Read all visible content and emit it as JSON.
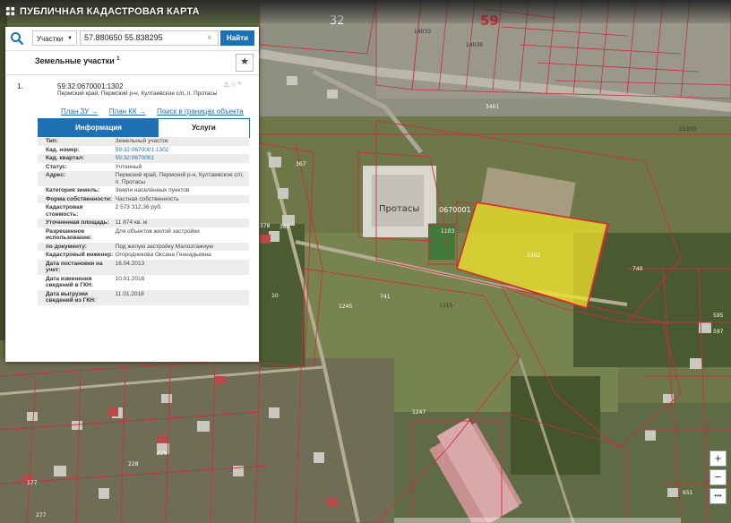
{
  "app": {
    "title": "ПУБЛИЧНАЯ КАДАСТРОВАЯ КАРТА"
  },
  "search": {
    "type_label": "Участки",
    "query": "57.880650 55.838295",
    "find_label": "Найти"
  },
  "panel": {
    "title": "Земельные участки",
    "title_sup": "1"
  },
  "result": {
    "number": "1.",
    "cad_number": "59:32:0670001:1302",
    "address": "Пермский край, Пермский р-н, Култаевское с/п, п. Протасы",
    "links": [
      "План ЗУ →",
      "План КК →",
      "Поиск в границах объекта →"
    ]
  },
  "tabs": {
    "info": "Информация",
    "services": "Услуги"
  },
  "properties": [
    {
      "label": "Тип:",
      "value": "Земельный участок"
    },
    {
      "label": "Кад. номер:",
      "value": "59:32:0670001:1302"
    },
    {
      "label": "Кад. квартал:",
      "value": "59:32:0670001"
    },
    {
      "label": "Статус:",
      "value": "Учтенный"
    },
    {
      "label": "Адрес:",
      "value": "Пермский край, Пермский р-н, Култаевское с/п, п. Протасы"
    },
    {
      "label": "Категория земель:",
      "value": "Земли населённых пунктов"
    },
    {
      "label": "Форма собственности:",
      "value": "Частная собственность"
    },
    {
      "label": "Кадастровая стоимость:",
      "value": "2 573 312,36 руб."
    },
    {
      "label": "Уточненная площадь:",
      "value": "11 874 кв. м"
    },
    {
      "label": "Разрешенное использование:",
      "value": "Для объектов жилой застройки"
    },
    {
      "label": "по документу:",
      "value": "Под жилую застройку Малоэтажную"
    },
    {
      "label": "Кадастровый инженер:",
      "value": "Огородникова Оксана Геннадьевна"
    },
    {
      "label": "Дата постановки на учет:",
      "value": "16.04.2013"
    },
    {
      "label": "Дата изменения сведений в ГКН:",
      "value": "10.01.2018"
    },
    {
      "label": "Дата выгрузки сведений из ГКН:",
      "value": "11.01.2018"
    }
  ],
  "map": {
    "labels": [
      {
        "text": "59",
        "kind": "big"
      },
      {
        "text": "32",
        "kind": "big"
      },
      {
        "text": "Протасы",
        "kind": "place"
      },
      {
        "text": "0670001",
        "kind": "quarter"
      },
      {
        "text": "1302",
        "kind": "parcel"
      },
      {
        "text": "1103",
        "kind": "parcel"
      },
      {
        "text": "3401",
        "kind": "parcel"
      },
      {
        "text": "740",
        "kind": "parcel"
      },
      {
        "text": "741",
        "kind": "parcel"
      },
      {
        "text": "1245",
        "kind": "parcel"
      },
      {
        "text": "1247",
        "kind": "parcel"
      },
      {
        "text": "1315",
        "kind": "parcel"
      },
      {
        "text": "14033",
        "kind": "parcel"
      },
      {
        "text": "14036",
        "kind": "parcel"
      },
      {
        "text": "15350",
        "kind": "parcel"
      },
      {
        "text": "367",
        "kind": "parcel"
      },
      {
        "text": "389",
        "kind": "parcel"
      },
      {
        "text": "10",
        "kind": "parcel"
      },
      {
        "text": "378",
        "kind": "parcel"
      },
      {
        "text": "595",
        "kind": "parcel"
      },
      {
        "text": "597",
        "kind": "parcel"
      },
      {
        "text": "651",
        "kind": "parcel"
      },
      {
        "text": "277",
        "kind": "parcel"
      },
      {
        "text": "177",
        "kind": "parcel"
      },
      {
        "text": "228",
        "kind": "parcel"
      },
      {
        "text": "229",
        "kind": "parcel"
      }
    ],
    "colors": {
      "parcel_boundary": "#c8313a",
      "selected_fill": "#f1e629",
      "selected_stroke": "#d12e2e",
      "accent": "#1f6fb4"
    }
  },
  "controls": {
    "zoom_in": "+",
    "zoom_out": "−",
    "more": "•••"
  }
}
